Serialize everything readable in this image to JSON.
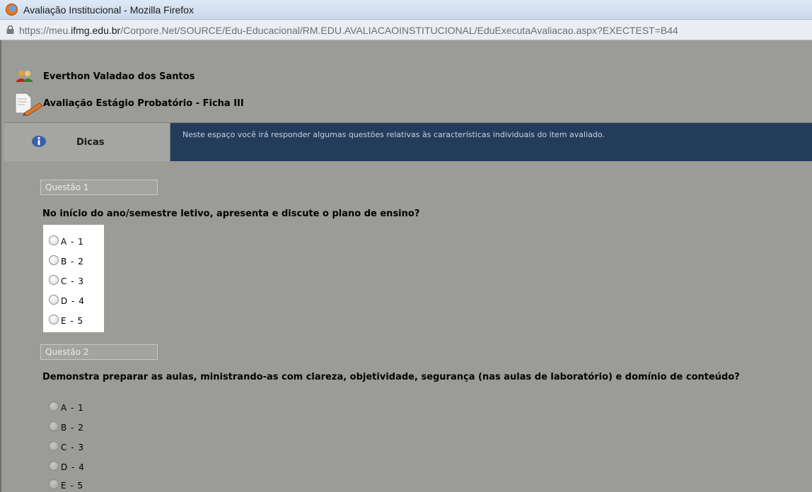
{
  "window": {
    "title": "Avaliação Institucional - Mozilla Firefox"
  },
  "address_bar": {
    "url_prefix": "https://meu.",
    "url_domain": "ifmg.edu.br",
    "url_path": "/Corpore.Net/SOURCE/Edu-Educacional/RM.EDU.AVALIACAOINSTITUCIONAL/EduExecutaAvaliacao.aspx?EXECTEST=B44"
  },
  "header": {
    "user_name": "Everthon Valadao dos Santos",
    "evaluation_title": "Avaliação Estágio Probatório - Ficha III"
  },
  "tips": {
    "label": "Dicas",
    "text": "Neste espaço você irá responder algumas questões relativas às características individuais do item avaliado."
  },
  "questions": [
    {
      "number_label": "Questão 1",
      "text": "No início do ano/semestre letivo, apresenta e discute o plano de ensino?",
      "options": [
        "A - 1",
        "B - 2",
        "C - 3",
        "D - 4",
        "E - 5"
      ]
    },
    {
      "number_label": "Questão 2",
      "text": "Demonstra preparar as aulas, ministrando-as com clareza, objetividade, segurança (nas aulas de laboratório) e domínio de conteúdo?",
      "options": [
        "A - 1",
        "B - 2",
        "C - 3",
        "D - 4",
        "E - 5"
      ]
    }
  ],
  "colors": {
    "page_background": "#9b9c97",
    "tips_panel": "#243c5c",
    "tips_text": "#c9d3df"
  }
}
